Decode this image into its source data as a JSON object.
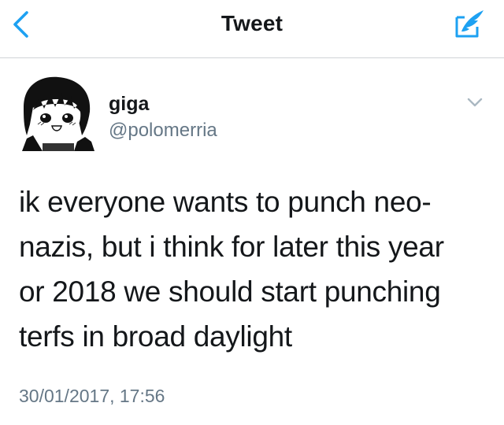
{
  "nav": {
    "title": "Tweet",
    "back_icon": "chevron-left-icon",
    "compose_icon": "compose-tweet-icon",
    "accent_color": "#1da1f2"
  },
  "tweet": {
    "author": {
      "display_name": "giga",
      "handle": "@polomerria",
      "avatar": "manga-character-avatar"
    },
    "menu_icon": "chevron-down-icon",
    "text_lines": [
      "ik everyone wants to punch neo-",
      "nazis, but i think for later this year",
      "or 2018 we should start punching",
      "terfs in broad daylight"
    ],
    "timestamp": "30/01/2017, 17:56"
  }
}
